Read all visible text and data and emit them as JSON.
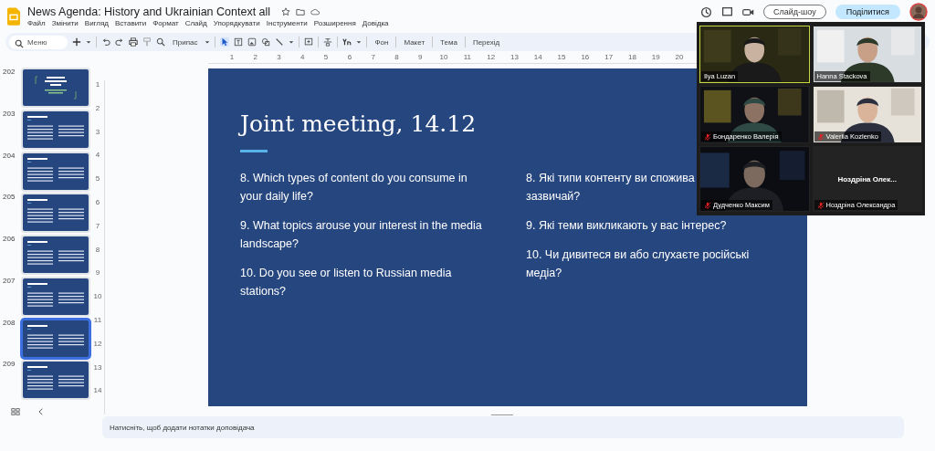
{
  "document": {
    "title": "News Agenda:  History and Ukrainian Context all"
  },
  "menu": [
    "Файл",
    "Змінити",
    "Вигляд",
    "Вставити",
    "Формат",
    "Слайд",
    "Упорядкувати",
    "Інструменти",
    "Розширення",
    "Довідка"
  ],
  "header_buttons": {
    "slideshow": "Слайд-шоу",
    "share": "Поділитися"
  },
  "toolbar": {
    "search_placeholder": "Меню",
    "zoom": "Припас",
    "text_buttons": [
      "Фон",
      "Макет",
      "Тема",
      "Перехід"
    ]
  },
  "ruler": {
    "horizontal": [
      "1",
      "2",
      "3",
      "4",
      "5",
      "6",
      "7",
      "8",
      "9",
      "10",
      "11",
      "12",
      "13",
      "14",
      "15",
      "16",
      "17",
      "18",
      "19",
      "20"
    ],
    "vertical": [
      "1",
      "2",
      "3",
      "4",
      "5",
      "6",
      "7",
      "8",
      "9",
      "10",
      "11",
      "12",
      "13",
      "14"
    ]
  },
  "filmstrip": [
    {
      "number": "202",
      "kind": "title",
      "selected": false
    },
    {
      "number": "203",
      "kind": "content",
      "selected": false
    },
    {
      "number": "204",
      "kind": "content",
      "selected": false
    },
    {
      "number": "205",
      "kind": "content",
      "selected": false
    },
    {
      "number": "206",
      "kind": "content",
      "selected": false
    },
    {
      "number": "207",
      "kind": "content",
      "selected": false
    },
    {
      "number": "208",
      "kind": "content",
      "selected": true
    },
    {
      "number": "209",
      "kind": "content",
      "selected": false
    }
  ],
  "slide": {
    "title": "Joint meeting, 14.12",
    "left_questions": [
      {
        "lines": [
          "8. Which types of content do you consume in",
          "your daily life?"
        ]
      },
      {
        "lines": [
          "9. What topics arouse your interest in the media",
          "landscape?"
        ]
      },
      {
        "lines": [
          "10. Do you see or listen to Russian media",
          "stations?"
        ]
      }
    ],
    "right_questions": [
      {
        "lines": [
          "8. Які типи контенту ви спожива",
          "зазвичай?"
        ]
      },
      {
        "lines": [
          "9. Які теми викликають у вас інтерес?"
        ]
      },
      {
        "lines": [
          "10. Чи дивитеся ви або слухаєте російські",
          "медіа?"
        ]
      }
    ]
  },
  "speaker_notes": {
    "placeholder": "Натисніть, щоб додати нотатки доповідача"
  },
  "video_call": [
    {
      "kind": "video",
      "name": "Ilya Luzan",
      "muted": false,
      "speaking": true
    },
    {
      "kind": "video",
      "name": "Hanna Stackova",
      "muted": false,
      "speaking": false
    },
    {
      "kind": "video",
      "name": "Бондаренко Валерія",
      "muted": true,
      "speaking": false
    },
    {
      "kind": "video",
      "name": "Valeriia Kozlenko",
      "muted": true,
      "speaking": false
    },
    {
      "kind": "video",
      "name": "Дудченко Максим",
      "muted": true,
      "speaking": false
    },
    {
      "kind": "avatar",
      "display_name": "Ноздріна Олек...",
      "name": "Ноздріна Олександра",
      "muted": true,
      "speaking": false
    }
  ]
}
